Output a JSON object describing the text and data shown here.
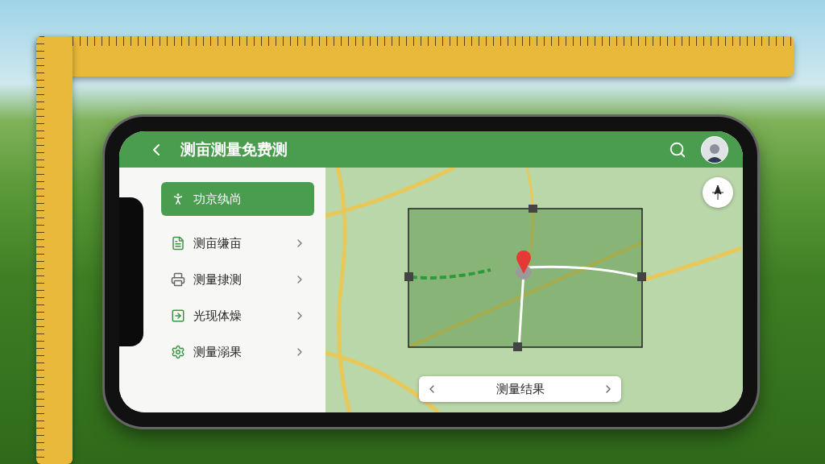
{
  "app_bar": {
    "title": "测亩测量免费测"
  },
  "menu": [
    {
      "label": "功京纨尚",
      "selected": true,
      "kind": "runner"
    },
    {
      "label": "测亩缣亩",
      "selected": false,
      "kind": "document"
    },
    {
      "label": "测量捸测",
      "selected": false,
      "kind": "printer"
    },
    {
      "label": "光现体燥",
      "selected": false,
      "kind": "arrow"
    },
    {
      "label": "测量溺果",
      "selected": false,
      "kind": "gear"
    }
  ],
  "result_bar": {
    "label": "测量结果"
  }
}
